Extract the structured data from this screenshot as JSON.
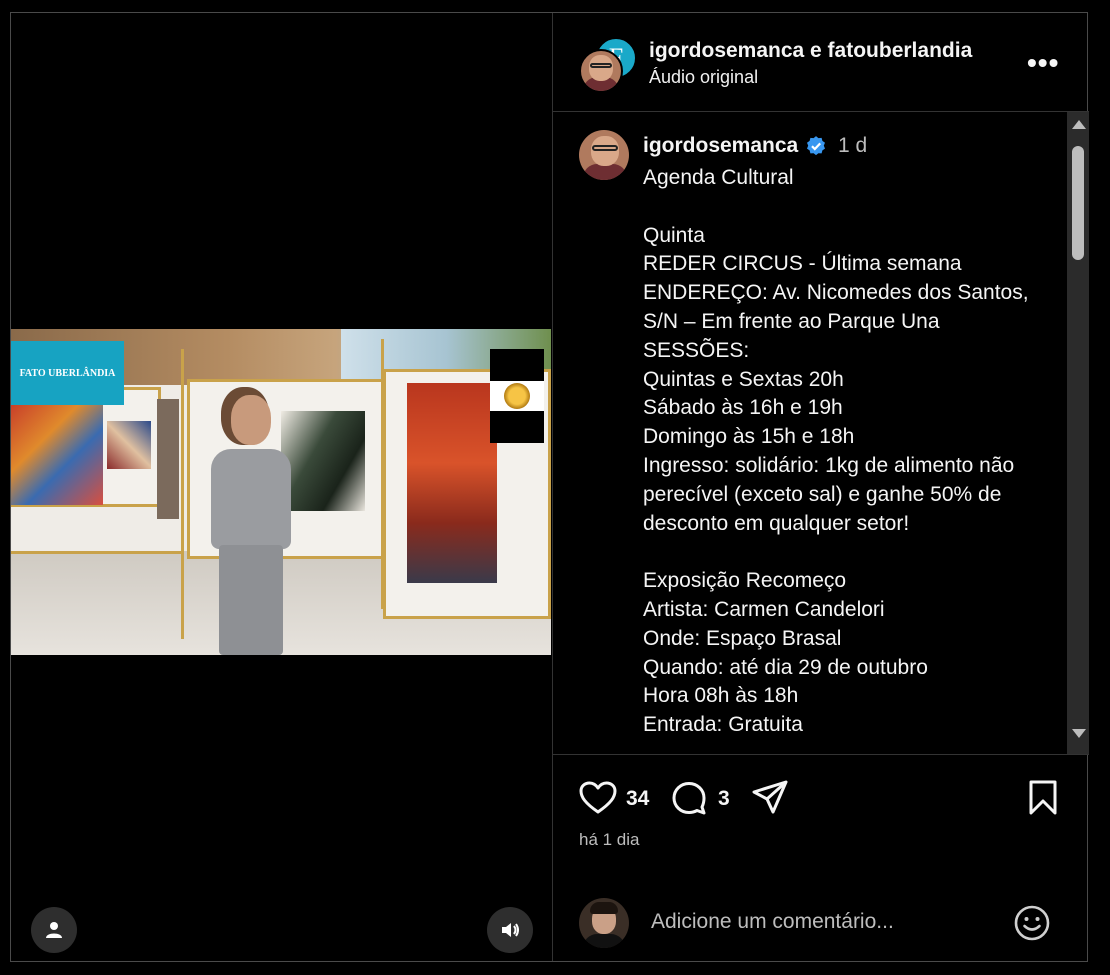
{
  "post": {
    "authors_line": "igordosemanca e fatouberlandia",
    "audio_label": "Áudio original",
    "more_label": "•••"
  },
  "video": {
    "watermark_text": "FATO UBERLÂNDIA",
    "secondary_avatar_letter": "F"
  },
  "caption": {
    "username": "igordosemanca",
    "time": "1 d",
    "lines": [
      "Agenda Cultural",
      "",
      "Quinta",
      "REDER CIRCUS - Última semana",
      "ENDEREÇO: Av. Nicomedes dos Santos,",
      "S/N – Em frente ao Parque Una",
      "SESSÕES:",
      "Quintas e Sextas 20h",
      "Sábado às 16h e 19h",
      "Domingo às 15h e 18h",
      "Ingresso: solidário: 1kg de alimento não",
      "perecível (exceto sal) e ganhe 50% de",
      "desconto em qualquer setor!",
      "",
      "Exposição Recomeço",
      "Artista: Carmen Candelori",
      "Onde: Espaço Brasal",
      "Quando: até dia 29 de outubro",
      "Hora 08h às 18h",
      "Entrada: Gratuita"
    ]
  },
  "actions": {
    "likes": "34",
    "comments": "3",
    "posted_ago": "há 1 dia"
  },
  "comment_box": {
    "placeholder": "Adicione um comentário..."
  },
  "icons": {
    "verified_color": "#3897f0",
    "accent_border": "#333333"
  }
}
